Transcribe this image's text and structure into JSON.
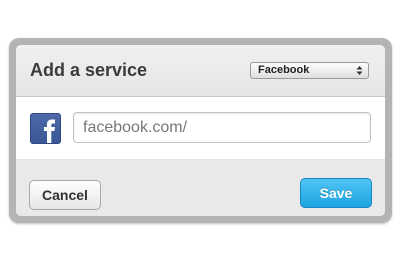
{
  "dialog": {
    "title": "Add a service",
    "service_select": {
      "selected": "Facebook"
    },
    "service_icon": "facebook-icon",
    "url_input": {
      "value": "",
      "placeholder": "facebook.com/"
    },
    "buttons": {
      "cancel_label": "Cancel",
      "save_label": "Save"
    }
  },
  "colors": {
    "brand_facebook": "#3b5998",
    "save_button": "#1da3e2",
    "frame": "#b4b4b4"
  }
}
